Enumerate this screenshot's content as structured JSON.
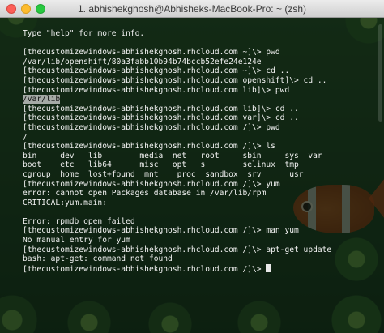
{
  "window": {
    "title": "1. abhishekghosh@Abhisheks-MacBook-Pro: ~ (zsh)"
  },
  "terminal": {
    "lines": [
      "Type \"help\" for more info.",
      "",
      "[thecustomizewindows-abhishekghosh.rhcloud.com ~]\\> pwd",
      "/var/lib/openshift/80a3fabb10b94b74bccb52efe24e124e",
      "[thecustomizewindows-abhishekghosh.rhcloud.com ~]\\> cd ..",
      "[thecustomizewindows-abhishekghosh.rhcloud.com openshift]\\> cd ..",
      "[thecustomizewindows-abhishekghosh.rhcloud.com lib]\\> pwd",
      "/var/lib",
      "[thecustomizewindows-abhishekghosh.rhcloud.com lib]\\> cd ..",
      "[thecustomizewindows-abhishekghosh.rhcloud.com var]\\> cd ..",
      "[thecustomizewindows-abhishekghosh.rhcloud.com /]\\> pwd",
      "/",
      "[thecustomizewindows-abhishekghosh.rhcloud.com /]\\> ls",
      "bin     dev   lib        media  net   root     sbin     sys  var",
      "boot    etc   lib64      misc   opt   s        selinux  tmp",
      "cgroup  home  lost+found  mnt    proc  sandbox  srv      usr",
      "[thecustomizewindows-abhishekghosh.rhcloud.com /]\\> yum",
      "error: cannot open Packages database in /var/lib/rpm",
      "CRITICAL:yum.main:",
      "",
      "Error: rpmdb open failed",
      "[thecustomizewindows-abhishekghosh.rhcloud.com /]\\> man yum",
      "No manual entry for yum",
      "[thecustomizewindows-abhishekghosh.rhcloud.com /]\\> apt-get update",
      "bash: apt-get: command not found",
      "[thecustomizewindows-abhishekghosh.rhcloud.com /]\\> "
    ],
    "highlighted_line": "/var/lib"
  },
  "colors": {
    "terminal_text": "#f2f2f2",
    "terminal_bg": "#08120a",
    "titlebar": "#dcdcdc"
  }
}
